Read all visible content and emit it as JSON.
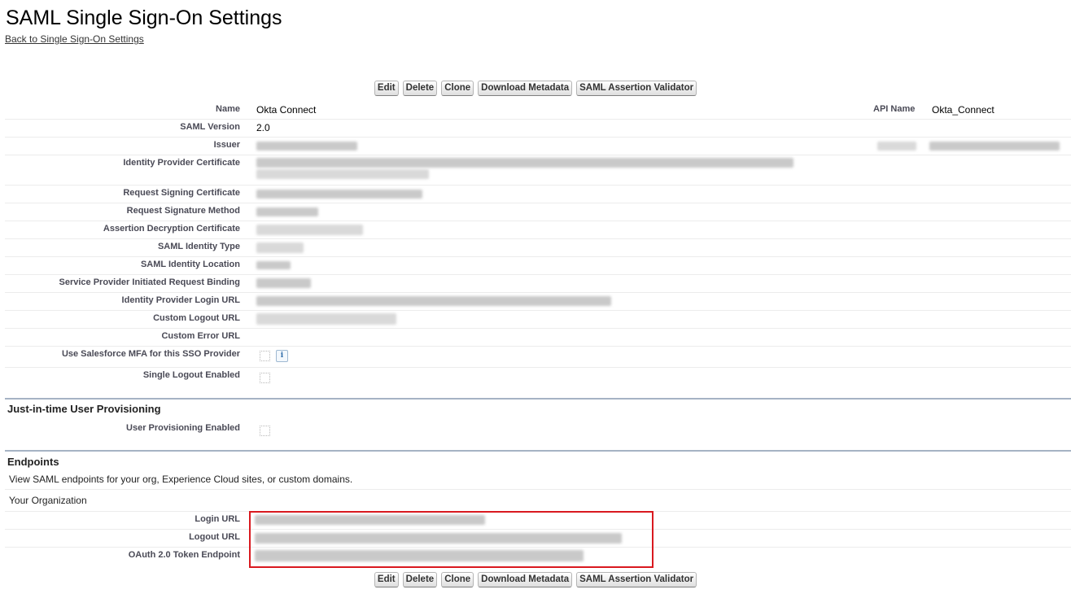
{
  "page": {
    "title": "SAML Single Sign-On Settings",
    "back_link": "Back to Single Sign-On Settings"
  },
  "toolbar": {
    "buttons": [
      "Edit",
      "Delete",
      "Clone",
      "Download Metadata",
      "SAML Assertion Validator"
    ]
  },
  "details": {
    "name_label": "Name",
    "name_value": "Okta Connect",
    "api_name_label": "API Name",
    "api_name_value": "Okta_Connect",
    "saml_version_label": "SAML Version",
    "saml_version_value": "2.0",
    "issuer_label": "Issuer",
    "idp_cert_label": "Identity Provider Certificate",
    "req_sign_cert_label": "Request Signing Certificate",
    "req_sign_method_label": "Request Signature Method",
    "assert_decrypt_label": "Assertion Decryption Certificate",
    "identity_type_label": "SAML Identity Type",
    "identity_location_label": "SAML Identity Location",
    "sp_binding_label": "Service Provider Initiated Request Binding",
    "idp_login_url_label": "Identity Provider Login URL",
    "custom_logout_label": "Custom Logout URL",
    "custom_error_label": "Custom Error URL",
    "mfa_label": "Use Salesforce MFA for this SSO Provider",
    "single_logout_label": "Single Logout Enabled",
    "info_icon_glyph": "i"
  },
  "jit": {
    "title": "Just-in-time User Provisioning",
    "user_prov_label": "User Provisioning Enabled"
  },
  "endpoints": {
    "title": "Endpoints",
    "description": "View SAML endpoints for your org, Experience Cloud sites, or custom domains.",
    "org_heading": "Your Organization",
    "login_url_label": "Login URL",
    "logout_url_label": "Logout URL",
    "oauth_label": "OAuth 2.0 Token Endpoint"
  },
  "colors": {
    "highlight_border": "#d9191f",
    "section_rule": "#a6b3c4",
    "label_text": "#4a4a56"
  }
}
